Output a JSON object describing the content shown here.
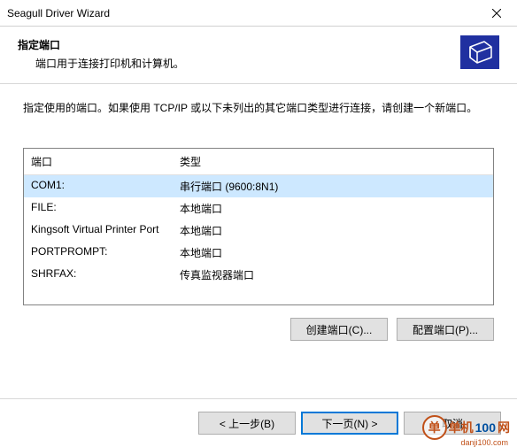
{
  "window": {
    "title": "Seagull Driver Wizard"
  },
  "header": {
    "title": "指定端口",
    "subtitle": "端口用于连接打印机和计算机。"
  },
  "instruction": "指定使用的端口。如果使用 TCP/IP 或以下未列出的其它端口类型进行连接，请创建一个新端口。",
  "columns": {
    "port": "端口",
    "type": "类型"
  },
  "rows": [
    {
      "port": "COM1:",
      "type": "串行端口 (9600:8N1)",
      "selected": true
    },
    {
      "port": "FILE:",
      "type": "本地端口",
      "selected": false
    },
    {
      "port": "Kingsoft Virtual Printer Port",
      "type": "本地端口",
      "selected": false
    },
    {
      "port": "PORTPROMPT:",
      "type": "本地端口",
      "selected": false
    },
    {
      "port": "SHRFAX:",
      "type": "传真监视器端口",
      "selected": false
    }
  ],
  "buttons": {
    "create": "创建端口(C)...",
    "config": "配置端口(P)...",
    "back": "< 上一步(B)",
    "next": "下一页(N) >",
    "cancel": "取消"
  },
  "watermark": {
    "circle": "单",
    "t1": "单机",
    "t2": "100",
    "t3": "网",
    "sub": "danji100.com"
  }
}
